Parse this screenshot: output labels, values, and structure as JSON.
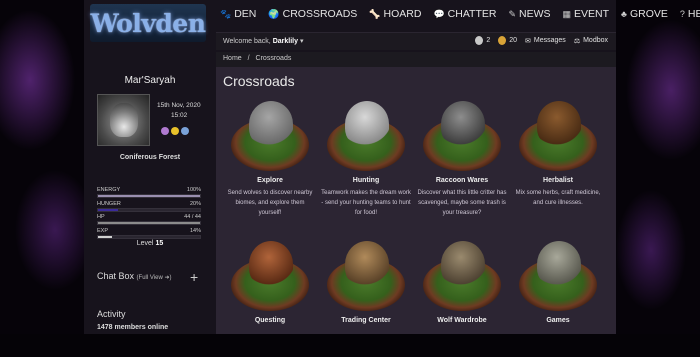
{
  "brand": {
    "logo_text": "Wolvden"
  },
  "nav": [
    {
      "icon": "paw-icon",
      "glyph": "🐾",
      "label": "DEN"
    },
    {
      "icon": "globe-icon",
      "glyph": "🌍",
      "label": "CROSSROADS"
    },
    {
      "icon": "bone-icon",
      "glyph": "🦴",
      "label": "HOARD"
    },
    {
      "icon": "chat-icon",
      "glyph": "💬",
      "label": "CHATTER"
    },
    {
      "icon": "feather-icon",
      "glyph": "✎",
      "label": "NEWS"
    },
    {
      "icon": "calendar-icon",
      "glyph": "▦",
      "label": "EVENT"
    },
    {
      "icon": "tree-icon",
      "glyph": "♣",
      "label": "GROVE"
    },
    {
      "icon": "help-icon",
      "glyph": "?",
      "label": "HELP"
    }
  ],
  "user_bar": {
    "welcome": "Welcome back,",
    "username": "Darklily",
    "currency1": "2",
    "currency2": "20",
    "messages": "Messages",
    "modbox": "Modbox"
  },
  "breadcrumb": {
    "home": "Home",
    "sep": "/",
    "current": "Crossroads"
  },
  "sidebar": {
    "wolf_name": "Mar'Saryah",
    "date": "15th Nov, 2020",
    "time": "15:02",
    "pack": "Coniferous Forest",
    "stats": [
      {
        "label": "ENERGY",
        "value": "100%",
        "fill": 1.0,
        "color": "#9a8fb0"
      },
      {
        "label": "HUNGER",
        "value": "20%",
        "fill": 0.2,
        "color": "#3b2b9a"
      },
      {
        "label": "HP",
        "value": "44 / 44",
        "fill": 1.0,
        "color": "#8c8c8c"
      },
      {
        "label": "EXP",
        "value": "14%",
        "fill": 0.14,
        "color": "#d0d0d0"
      }
    ],
    "level_label": "Level",
    "level": "15",
    "chat_title": "Chat Box",
    "chat_full": "(Full View ➜)",
    "activity": "Activity",
    "members_online": "1478 members online"
  },
  "page": {
    "title": "Crossroads",
    "cards": [
      {
        "name": "Explore",
        "desc": "Send wolves to discover nearby biomes, and explore them yourself!"
      },
      {
        "name": "Hunting",
        "desc": "Teamwork makes the dream work - send your hunting teams to hunt for food!"
      },
      {
        "name": "Raccoon Wares",
        "desc": "Discover what this little critter has scavenged, maybe some trash is your treasure?"
      },
      {
        "name": "Herbalist",
        "desc": "Mix some herbs, craft medicine, and cure illnesses."
      },
      {
        "name": "Questing",
        "desc": ""
      },
      {
        "name": "Trading Center",
        "desc": ""
      },
      {
        "name": "Wolf Wardrobe",
        "desc": ""
      },
      {
        "name": "Games",
        "desc": ""
      }
    ]
  },
  "colors": {
    "accent": "#8ab0e8",
    "panel": "#2c2533",
    "sidebar": "#17131c"
  }
}
